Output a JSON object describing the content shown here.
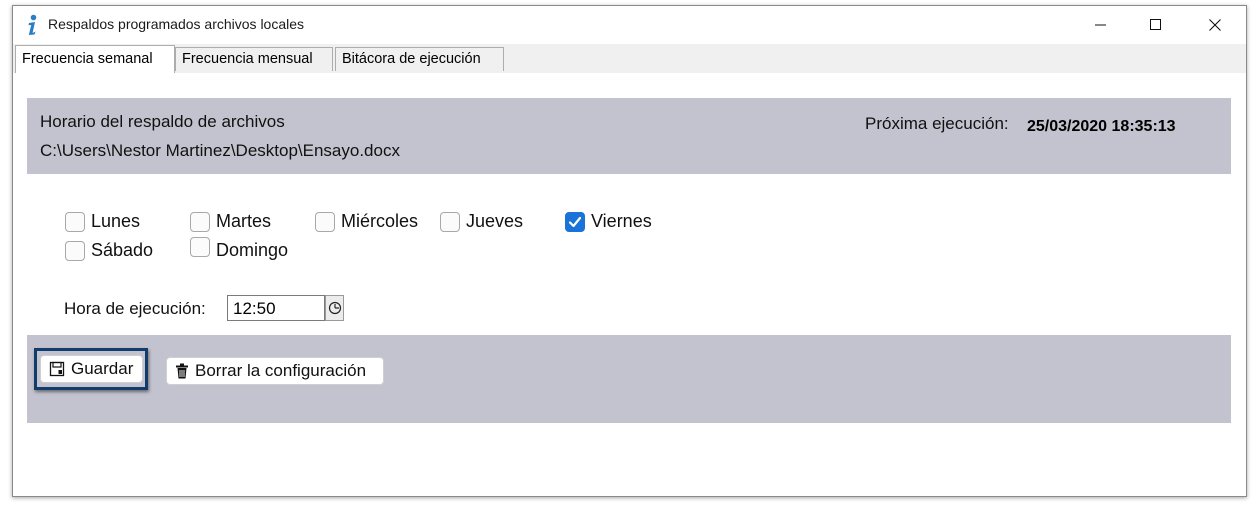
{
  "window": {
    "title": "Respaldos programados archivos locales",
    "controls": {
      "minimize": "minimize-icon",
      "maximize": "maximize-icon",
      "close": "close-icon"
    }
  },
  "tabs": [
    {
      "label": "Frecuencia semanal",
      "active": true
    },
    {
      "label": "Frecuencia mensual",
      "active": false
    },
    {
      "label": "Bitácora de ejecución",
      "active": false
    }
  ],
  "schedule": {
    "title": "Horario del respaldo de archivos",
    "path": "C:\\Users\\Nestor Martinez\\Desktop\\Ensayo.docx",
    "next_run_label": "Próxima ejecución:",
    "next_run_value": "25/03/2020 18:35:13"
  },
  "days": [
    {
      "label": "Lunes",
      "checked": false
    },
    {
      "label": "Martes",
      "checked": false
    },
    {
      "label": "Miércoles",
      "checked": false
    },
    {
      "label": "Jueves",
      "checked": false
    },
    {
      "label": "Viernes",
      "checked": true
    },
    {
      "label": "Sábado",
      "checked": false
    },
    {
      "label": "Domingo",
      "checked": false
    }
  ],
  "time": {
    "label": "Hora de ejecución:",
    "value": "12:50",
    "picker_icon": "clock-icon"
  },
  "actions": {
    "save_label": "Guardar",
    "save_icon": "save-icon",
    "clear_label": "Borrar la configuración",
    "clear_icon": "trash-icon"
  },
  "colors": {
    "panel": "#c3c3cf",
    "checkbox_checked": "#1a73d6",
    "focus_ring": "#123c6b",
    "app_icon": "#2a7fc4"
  }
}
